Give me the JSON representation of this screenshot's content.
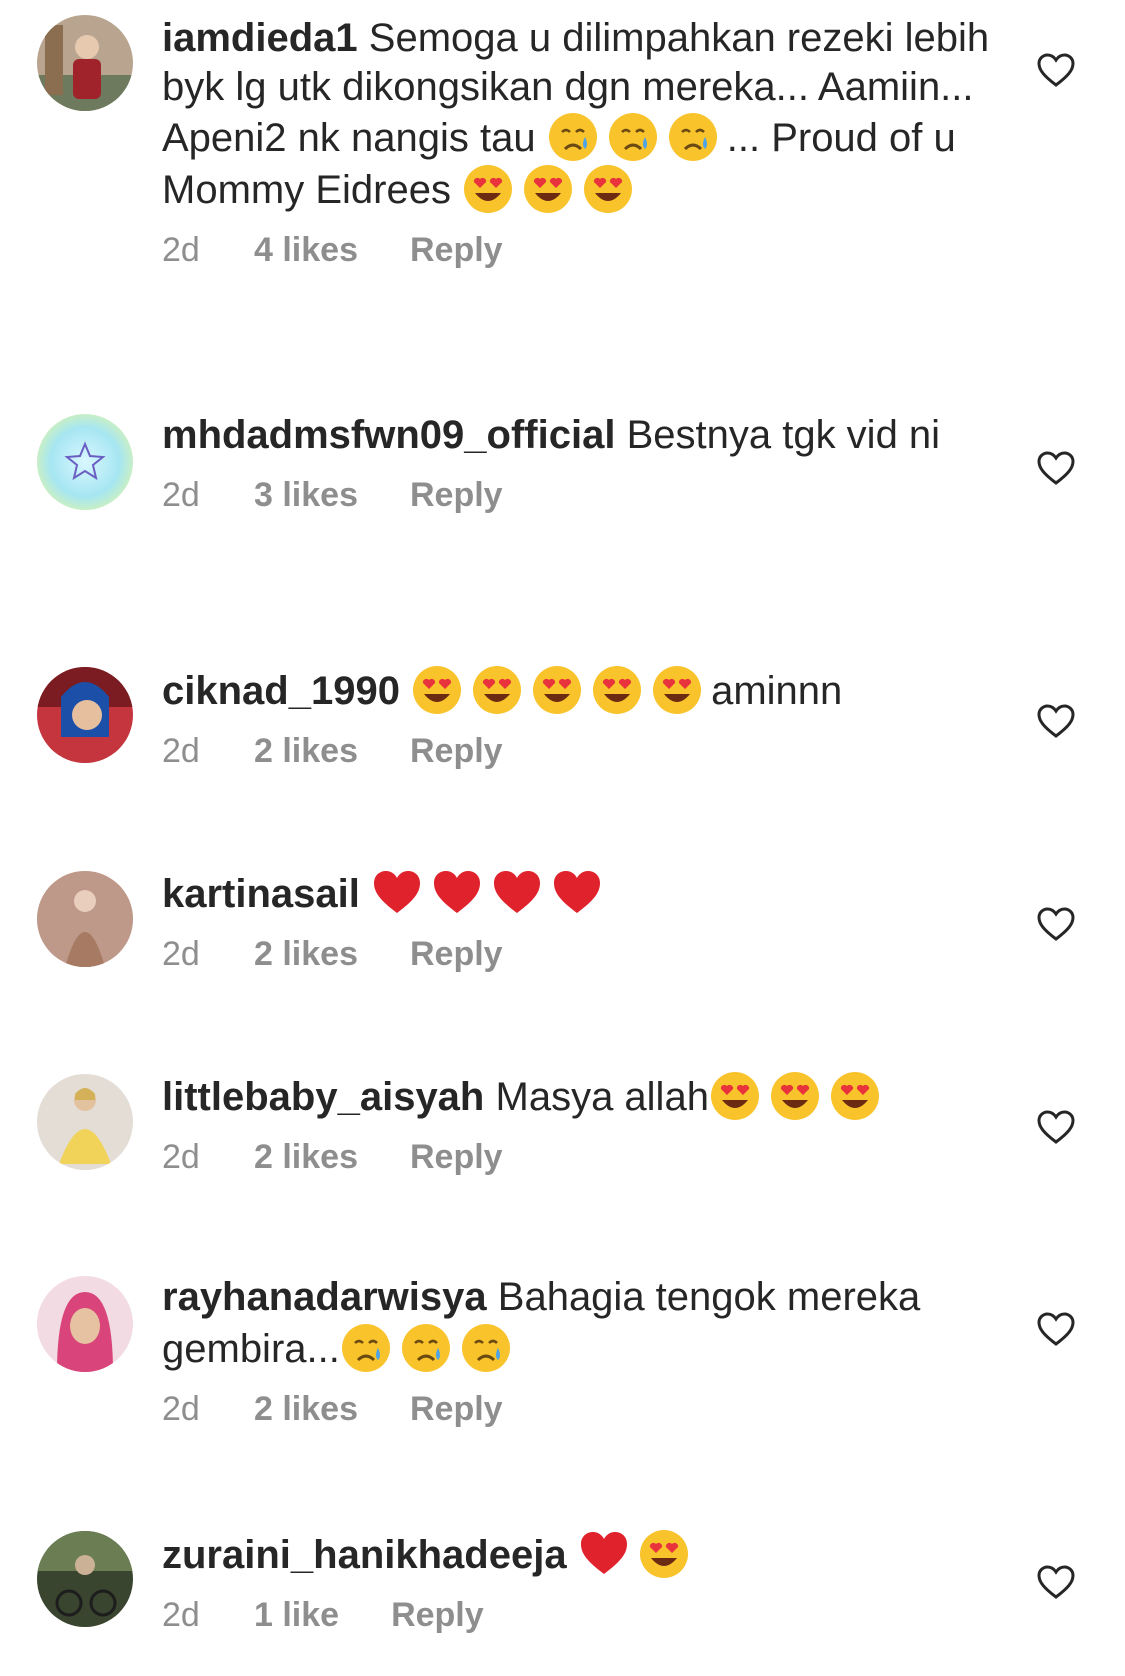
{
  "comments": [
    {
      "username": "iamdieda1",
      "segments": [
        {
          "text": "Semoga u dilimpahkan rezeki lebih byk lg utk dikongsikan dgn mereka... Aamiin... Apeni2 nk nangis tau "
        },
        {
          "emoji": "crying-face"
        },
        {
          "emoji": "crying-face"
        },
        {
          "emoji": "crying-face"
        },
        {
          "text": "... Proud of u Mommy Eidrees "
        },
        {
          "emoji": "heart-eyes"
        },
        {
          "emoji": "heart-eyes"
        },
        {
          "emoji": "heart-eyes"
        }
      ],
      "time": "2d",
      "likes": "4 likes",
      "reply": "Reply"
    },
    {
      "username": "mhdadmsfwn09_official",
      "segments": [
        {
          "text": "Bestnya tgk vid ni"
        }
      ],
      "time": "2d",
      "likes": "3 likes",
      "reply": "Reply"
    },
    {
      "username": "ciknad_1990",
      "segments": [
        {
          "emoji": "heart-eyes"
        },
        {
          "emoji": "heart-eyes"
        },
        {
          "emoji": "heart-eyes"
        },
        {
          "emoji": "heart-eyes"
        },
        {
          "emoji": "heart-eyes"
        },
        {
          "text": "aminnn"
        }
      ],
      "time": "2d",
      "likes": "2 likes",
      "reply": "Reply"
    },
    {
      "username": "kartinasail",
      "segments": [
        {
          "emoji": "red-heart"
        },
        {
          "emoji": "red-heart"
        },
        {
          "emoji": "red-heart"
        },
        {
          "emoji": "red-heart"
        }
      ],
      "time": "2d",
      "likes": "2 likes",
      "reply": "Reply"
    },
    {
      "username": "littlebaby_aisyah",
      "segments": [
        {
          "text": "Masya allah"
        },
        {
          "emoji": "heart-eyes"
        },
        {
          "emoji": "heart-eyes"
        },
        {
          "emoji": "heart-eyes"
        }
      ],
      "time": "2d",
      "likes": "2 likes",
      "reply": "Reply"
    },
    {
      "username": "rayhanadarwisya",
      "segments": [
        {
          "text": "Bahagia tengok mereka gembira..."
        },
        {
          "emoji": "crying-face"
        },
        {
          "emoji": "crying-face"
        },
        {
          "emoji": "crying-face"
        }
      ],
      "time": "2d",
      "likes": "2 likes",
      "reply": "Reply"
    },
    {
      "username": "zuraini_hanikhadeeja",
      "segments": [
        {
          "emoji": "red-heart"
        },
        {
          "emoji": "heart-eyes"
        }
      ],
      "time": "2d",
      "likes": "1 like",
      "reply": "Reply"
    }
  ],
  "colors": {
    "text": "#262626",
    "meta": "#8e8e8e",
    "heart_icon": "#262626"
  },
  "icons": {
    "like": "heart-outline-icon",
    "avatar": "profile-photo"
  }
}
